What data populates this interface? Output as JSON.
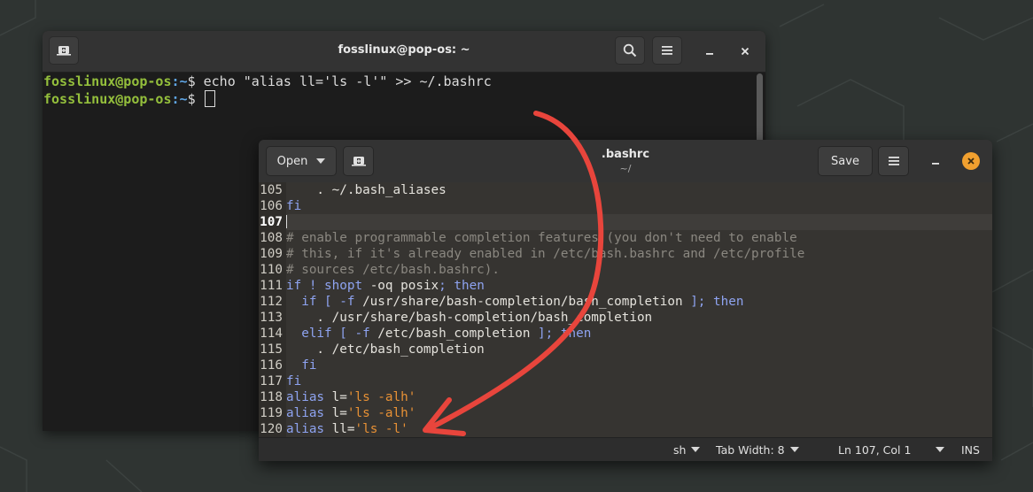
{
  "terminal": {
    "title": "fosslinux@pop-os: ~",
    "lines": [
      {
        "user": "fosslinux@pop-os",
        "path": ":~",
        "prompt": "$ ",
        "command": "echo \"alias ll='ls -l'\" >> ~/.bashrc"
      },
      {
        "user": "fosslinux@pop-os",
        "path": ":~",
        "prompt": "$ ",
        "command": ""
      }
    ]
  },
  "editor": {
    "title": ".bashrc",
    "subtitle": "~/",
    "open_label": "Open",
    "save_label": "Save",
    "lines": [
      {
        "num": "105",
        "segments": [
          {
            "t": "    . ~/.bash_aliases",
            "c": "txt"
          }
        ]
      },
      {
        "num": "106",
        "segments": [
          {
            "t": "fi",
            "c": "kw"
          }
        ]
      },
      {
        "num": "107",
        "segments": [],
        "current": true
      },
      {
        "num": "108",
        "segments": [
          {
            "t": "# enable programmable completion features (you don't need to enable",
            "c": "cm"
          }
        ]
      },
      {
        "num": "109",
        "segments": [
          {
            "t": "# this, if it's already enabled in /etc/bash.bashrc and /etc/profile",
            "c": "cm"
          }
        ]
      },
      {
        "num": "110",
        "segments": [
          {
            "t": "# sources /etc/bash.bashrc).",
            "c": "cm"
          }
        ]
      },
      {
        "num": "111",
        "segments": [
          {
            "t": "if",
            "c": "kw"
          },
          {
            "t": " ",
            "c": "txt"
          },
          {
            "t": "!",
            "c": "kw"
          },
          {
            "t": " ",
            "c": "txt"
          },
          {
            "t": "shopt",
            "c": "kw"
          },
          {
            "t": " -oq posix",
            "c": "txt"
          },
          {
            "t": "; then",
            "c": "kw"
          }
        ]
      },
      {
        "num": "112",
        "segments": [
          {
            "t": "  if [ -f ",
            "c": "kw"
          },
          {
            "t": "/usr/share/bash-completion/bash_completion",
            "c": "txt"
          },
          {
            "t": " ]; then",
            "c": "kw"
          }
        ]
      },
      {
        "num": "113",
        "segments": [
          {
            "t": "    . /usr/share/bash-completion/bash_completion",
            "c": "txt"
          }
        ]
      },
      {
        "num": "114",
        "segments": [
          {
            "t": "  elif [ -f ",
            "c": "kw"
          },
          {
            "t": "/etc/bash_completion",
            "c": "txt"
          },
          {
            "t": " ]; then",
            "c": "kw"
          }
        ]
      },
      {
        "num": "115",
        "segments": [
          {
            "t": "    . /etc/bash_completion",
            "c": "txt"
          }
        ]
      },
      {
        "num": "116",
        "segments": [
          {
            "t": "  fi",
            "c": "kw"
          }
        ]
      },
      {
        "num": "117",
        "segments": [
          {
            "t": "fi",
            "c": "kw"
          }
        ]
      },
      {
        "num": "118",
        "segments": [
          {
            "t": "alias",
            "c": "kw"
          },
          {
            "t": " l=",
            "c": "txt"
          },
          {
            "t": "'ls -alh'",
            "c": "str"
          }
        ]
      },
      {
        "num": "119",
        "segments": [
          {
            "t": "alias",
            "c": "kw"
          },
          {
            "t": " l=",
            "c": "txt"
          },
          {
            "t": "'ls -alh'",
            "c": "str"
          }
        ]
      },
      {
        "num": "120",
        "segments": [
          {
            "t": "alias",
            "c": "kw"
          },
          {
            "t": " ll=",
            "c": "txt"
          },
          {
            "t": "'ls -l'",
            "c": "str"
          }
        ]
      }
    ],
    "status": {
      "language": "sh",
      "tab_width": "Tab Width: 8",
      "position": "Ln 107, Col 1",
      "mode": "INS"
    }
  },
  "colors": {
    "prompt_user": "#94bf3c",
    "prompt_path": "#5fa6e6",
    "keyword": "#8ea3f0",
    "comment": "#8a8780",
    "string": "#e89135",
    "annotation_arrow": "#e8453c",
    "close_button": "#f1a02f"
  }
}
